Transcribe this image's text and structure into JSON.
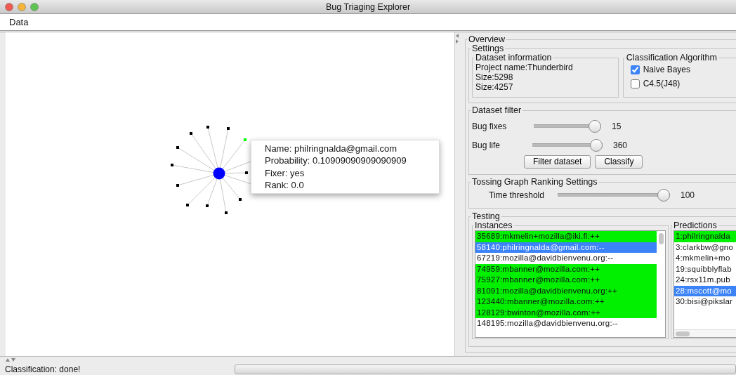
{
  "window": {
    "title": "Bug Triaging Explorer"
  },
  "menu_items": [
    {
      "label": "Data"
    }
  ],
  "graph": {
    "nodes": [
      {
        "color": "#000000"
      },
      {
        "color": "#000000"
      },
      {
        "color": "#000000"
      },
      {
        "color": "#00ff00"
      },
      {
        "color": "#000000"
      },
      {
        "color": "#000000"
      },
      {
        "color": "#000000"
      },
      {
        "color": "#000000"
      },
      {
        "color": "#000000"
      },
      {
        "color": "#000000"
      },
      {
        "color": "#000000"
      },
      {
        "color": "#000000"
      }
    ],
    "tooltip": {
      "lines": [
        "Name: philringnalda@gmail.com",
        "Probability: 0.10909090909090909",
        "Fixer: yes",
        "Rank: 0.0"
      ]
    }
  },
  "overview": {
    "title": "Overview",
    "settings": {
      "title": "Settings",
      "dataset_information": {
        "title": "Dataset information",
        "lines": [
          "Project name:Thunderbird",
          "Size:5298",
          "Size:4257"
        ]
      },
      "classification_algorithm": {
        "title": "Classification Algorithm",
        "options": [
          {
            "label": "Naive Bayes",
            "checked": true
          },
          {
            "label": "C4.5(J48)",
            "checked": false
          }
        ]
      }
    },
    "dataset_filter": {
      "title": "Dataset filter",
      "sliders": [
        {
          "label": "Bug fixes",
          "level": 1,
          "reading": "15"
        },
        {
          "label": "Bug life",
          "level": 1,
          "reading": "360"
        }
      ],
      "buttons": [
        "Filter dataset",
        "Classify"
      ]
    },
    "tossing_graph": {
      "title": "Tossing Graph Ranking Settings",
      "sliders": [
        {
          "label": "Time threshold",
          "level": 1,
          "reading": "100"
        }
      ]
    },
    "testing": {
      "title": "Testing",
      "instances": {
        "title": "Instances",
        "items": [
          {
            "text": "35689:mkmelin+mozilla@iki.fi:++",
            "correct": true,
            "selected": false
          },
          {
            "text": "58140:philringnalda@gmail.com:--",
            "correct": false,
            "selected": true
          },
          {
            "text": "67219:mozilla@davidbienvenu.org:--",
            "correct": false,
            "selected": false
          },
          {
            "text": "74959:mbanner@mozilla.com:++",
            "correct": true,
            "selected": false
          },
          {
            "text": "75927:mbanner@mozilla.com:++",
            "correct": true,
            "selected": false
          },
          {
            "text": "81091:mozilla@davidbienvenu.org:++",
            "correct": true,
            "selected": false
          },
          {
            "text": "123440:mbanner@mozilla.com:++",
            "correct": true,
            "selected": false
          },
          {
            "text": "128129:bwinton@mozilla.com:++",
            "correct": true,
            "selected": false
          },
          {
            "text": "148195:mozilla@davidbienvenu.org:--",
            "correct": false,
            "selected": false
          }
        ]
      },
      "predictions": {
        "title": "Predictions",
        "items": [
          {
            "text": "1:philringnalda",
            "correct": true,
            "selected": false
          },
          {
            "text": "3:clarkbw@gno",
            "correct": false,
            "selected": false
          },
          {
            "text": "4:mkmelin+mo",
            "correct": false,
            "selected": false
          },
          {
            "text": "19:squibblyflab",
            "correct": false,
            "selected": false
          },
          {
            "text": "24:rsx11m.pub",
            "correct": false,
            "selected": false
          },
          {
            "text": "28:mscott@mo",
            "correct": false,
            "selected": true
          },
          {
            "text": "30:bisi@pikslar",
            "correct": false,
            "selected": false
          }
        ]
      }
    }
  },
  "status_bar": {
    "text": "Classification: done!",
    "progress": {
      "level": 0
    }
  }
}
